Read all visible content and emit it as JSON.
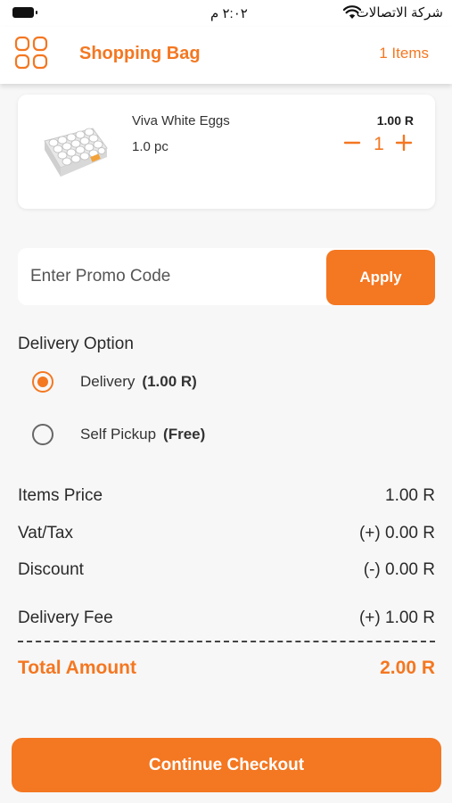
{
  "status_bar": {
    "time": "٢:٠٢ م",
    "carrier": "شركة الاتصالات"
  },
  "header": {
    "title": "Shopping Bag",
    "items_count": "1 Items",
    "menu_icon": "grid-menu-icon"
  },
  "cart": {
    "items": [
      {
        "name": "Viva White Eggs",
        "quantity_label": "1.0 pc",
        "price": "1.00 R",
        "quantity": "1",
        "image_icon": "egg-tray-image"
      }
    ]
  },
  "promo": {
    "placeholder": "Enter Promo Code",
    "value": "",
    "apply_label": "Apply"
  },
  "delivery": {
    "title": "Delivery Option",
    "options": [
      {
        "label": "Delivery",
        "note": "(1.00 R)",
        "selected": true
      },
      {
        "label": "Self Pickup",
        "note": "(Free)",
        "selected": false
      }
    ]
  },
  "summary": {
    "items_price_label": "Items Price",
    "items_price": "1.00 R",
    "vat_label": "Vat/Tax",
    "vat": "(+) 0.00 R",
    "discount_label": "Discount",
    "discount": "(-) 0.00 R",
    "delivery_fee_label": "Delivery Fee",
    "delivery_fee": "(+) 1.00 R",
    "total_label": "Total Amount",
    "total": "2.00 R"
  },
  "checkout": {
    "label": "Continue Checkout"
  },
  "colors": {
    "accent": "#f47721",
    "background": "#f7f7f7",
    "card": "#ffffff",
    "text": "#2a2a2a"
  }
}
